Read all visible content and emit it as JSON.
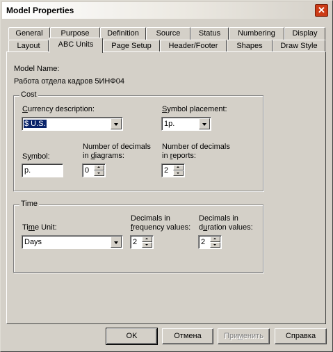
{
  "window": {
    "title": "Model Properties",
    "close_label": "✕"
  },
  "tabs": {
    "row1": [
      "General",
      "Purpose",
      "Definition",
      "Source",
      "Status",
      "Numbering",
      "Display"
    ],
    "row2": [
      "Layout",
      "ABC Units",
      "Page Setup",
      "Header/Footer",
      "Shapes",
      "Draw Style"
    ],
    "active": "ABC Units"
  },
  "model": {
    "name_label": "Model Name:",
    "name_value": "Работа отдела кадров 5ИНФ04"
  },
  "cost": {
    "group_title": "Cost",
    "currency_label_pre": "",
    "currency_label_u": "C",
    "currency_label_post": "urrency description:",
    "currency_value": "$ U.S.",
    "symbol_placement_label_u": "S",
    "symbol_placement_label_post": "ymbol placement:",
    "symbol_placement_value": "1p.",
    "symbol_label_pre": "S",
    "symbol_label_u": "y",
    "symbol_label_post": "mbol:",
    "symbol_value": "p.",
    "decimals_diagrams_line1": "Number of decimals",
    "decimals_diagrams_line2_pre": "in ",
    "decimals_diagrams_line2_u": "d",
    "decimals_diagrams_line2_post": "iagrams:",
    "decimals_diagrams_value": "0",
    "decimals_reports_line1": "Number of decimals",
    "decimals_reports_line2_pre": "in ",
    "decimals_reports_line2_u": "r",
    "decimals_reports_line2_post": "eports:",
    "decimals_reports_value": "2"
  },
  "time": {
    "group_title": "Time",
    "time_unit_label_pre": "Ti",
    "time_unit_label_u": "m",
    "time_unit_label_post": "e Unit:",
    "time_unit_value": "Days",
    "freq_line1": "Decimals in",
    "freq_line2_u": "f",
    "freq_line2_post": "requency values:",
    "freq_value": "2",
    "dur_line1": "Decimals in",
    "dur_line2_pre": "d",
    "dur_line2_u": "u",
    "dur_line2_post": "ration values:",
    "dur_value": "2"
  },
  "buttons": {
    "ok": "OK",
    "cancel": "Отмена",
    "apply_pre": "При",
    "apply_u": "м",
    "apply_post": "енить",
    "help": "Справка"
  }
}
